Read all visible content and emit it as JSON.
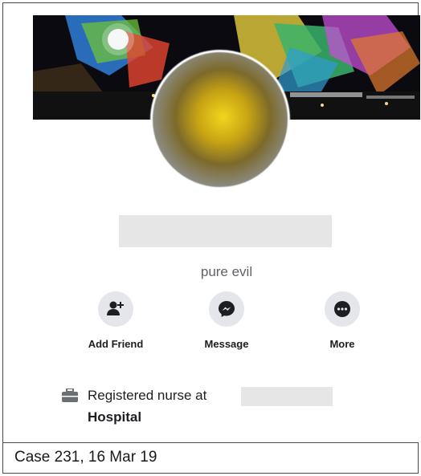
{
  "profile": {
    "bio": "pure evil",
    "name_redacted": true
  },
  "actions": [
    {
      "label": "Add Friend",
      "icon": "add-friend-icon"
    },
    {
      "label": "Message",
      "icon": "messenger-icon"
    },
    {
      "label": "More",
      "icon": "more-icon"
    }
  ],
  "about": {
    "job_prefix": "Registered nurse at",
    "job_suffix": "Hospital",
    "icon": "briefcase-icon"
  },
  "caption": "Case 231, 16 Mar 19",
  "colors": {
    "action_bg": "#e4e6eb",
    "text_primary": "#1c1e21",
    "text_secondary": "#5f6368",
    "redaction": "#e6e6e6"
  }
}
